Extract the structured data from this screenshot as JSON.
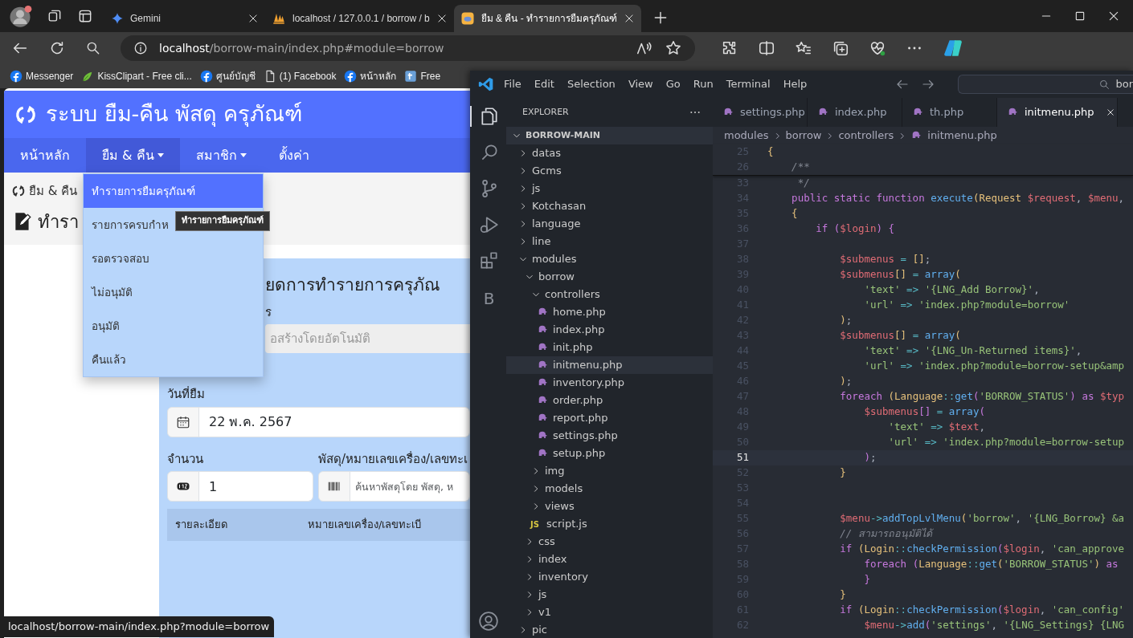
{
  "browser": {
    "tabs": [
      {
        "title": "Gemini",
        "kind": "sparkle",
        "selected": false
      },
      {
        "title": "localhost / 127.0.0.1 / borrow / b",
        "kind": "boat",
        "selected": false
      },
      {
        "title": "ยืม & คืน - ทำรายการยืมครุภัณฑ์",
        "kind": "app",
        "selected": true
      }
    ],
    "address": {
      "host": "localhost",
      "path": "/borrow-main/index.php#module=borrow"
    },
    "bookmarks": [
      {
        "label": "Messenger",
        "kind": "social"
      },
      {
        "label": "KissClipart - Free cli...",
        "kind": "leaf"
      },
      {
        "label": "ศูนย์บัญชี",
        "kind": "social"
      },
      {
        "label": "(1) Facebook",
        "kind": "page"
      },
      {
        "label": "หน้าหลัก",
        "kind": "social"
      },
      {
        "label": "Free",
        "kind": "tile"
      }
    ],
    "status_url": "localhost/borrow-main/index.php?module=borrow"
  },
  "page": {
    "site_title": "ระบบ ยืม-คืน พัสดุ ครุภัณฑ์",
    "nav": [
      {
        "label": "หน้าหลัก",
        "dropdown": false,
        "selected": false
      },
      {
        "label": "ยืม & คืน",
        "dropdown": true,
        "selected": true
      },
      {
        "label": "สมาชิก",
        "dropdown": true,
        "selected": false
      },
      {
        "label": "ตั้งค่า",
        "dropdown": false,
        "selected": false
      }
    ],
    "dropdown_menu": [
      {
        "label": "ทำรายการยืมครุภัณฑ์",
        "selected": true
      },
      {
        "label": "รายการครบกำห",
        "selected": false
      },
      {
        "label": "รอตรวจสอบ",
        "selected": false
      },
      {
        "label": "ไม่อนุมัติ",
        "selected": false
      },
      {
        "label": "อนุมัติ",
        "selected": false
      },
      {
        "label": "คืนแล้ว",
        "selected": false
      }
    ],
    "tooltip": "ทำรายการยืมครุภัณฑ์",
    "breadcrumb": "ยืม & คืน",
    "page_title": "ทำรา",
    "form": {
      "title": "ยดการทำรายการครุภัณ",
      "number_label": "ร",
      "number_placeholder": "อสร้างโดยอัตโนมัติ",
      "date_label": "วันที่ยืม",
      "date_value": "22 พ.ค. 2567",
      "quantity_label": "จำนวน",
      "quantity_value": "1",
      "item_label": "พัสดุ/หมายเลขเครื่อง/เลขทะเ",
      "item_placeholder": "ค้นหาพัสดุโดย พัสดุ, ห",
      "table_columns": [
        "รายละเอียด",
        "หมายเลขเครื่อง/เลขทะเบี"
      ]
    }
  },
  "vscode": {
    "menu": [
      "File",
      "Edit",
      "Selection",
      "View",
      "Go",
      "Run",
      "Terminal",
      "Help"
    ],
    "search": "bor",
    "activity": [
      {
        "kind": "files",
        "selected": true
      },
      {
        "kind": "search",
        "selected": false
      },
      {
        "kind": "source-control",
        "selected": false
      },
      {
        "kind": "debug",
        "selected": false
      },
      {
        "kind": "extensions",
        "selected": false
      },
      {
        "kind": "letter",
        "text": "B",
        "selected": false
      }
    ],
    "explorer": {
      "title": "EXPLORER",
      "root": {
        "label": "BORROW-MAIN",
        "kind": "folder",
        "expanded": true,
        "children": [
          {
            "label": "datas",
            "kind": "folder",
            "expanded": false,
            "selected": false
          },
          {
            "label": "Gcms",
            "kind": "folder",
            "expanded": false,
            "selected": false
          },
          {
            "label": "js",
            "kind": "folder",
            "expanded": false,
            "selected": false
          },
          {
            "label": "Kotchasan",
            "kind": "folder",
            "expanded": false,
            "selected": false
          },
          {
            "label": "language",
            "kind": "folder",
            "expanded": false,
            "selected": false
          },
          {
            "label": "line",
            "kind": "folder",
            "expanded": false,
            "selected": false
          },
          {
            "label": "modules",
            "kind": "folder",
            "expanded": true,
            "selected": false,
            "children": [
              {
                "label": "borrow",
                "kind": "folder",
                "expanded": true,
                "selected": false,
                "children": [
                  {
                    "label": "controllers",
                    "kind": "folder",
                    "expanded": true,
                    "selected": false,
                    "children": [
                      {
                        "label": "home.php",
                        "kind": "php",
                        "selected": false
                      },
                      {
                        "label": "index.php",
                        "kind": "php",
                        "selected": false
                      },
                      {
                        "label": "init.php",
                        "kind": "php",
                        "selected": false
                      },
                      {
                        "label": "initmenu.php",
                        "kind": "php",
                        "selected": true
                      },
                      {
                        "label": "inventory.php",
                        "kind": "php",
                        "selected": false
                      },
                      {
                        "label": "order.php",
                        "kind": "php",
                        "selected": false
                      },
                      {
                        "label": "report.php",
                        "kind": "php",
                        "selected": false
                      },
                      {
                        "label": "settings.php",
                        "kind": "php",
                        "selected": false
                      },
                      {
                        "label": "setup.php",
                        "kind": "php",
                        "selected": false
                      }
                    ]
                  },
                  {
                    "label": "img",
                    "kind": "folder",
                    "expanded": false,
                    "selected": false
                  },
                  {
                    "label": "models",
                    "kind": "folder",
                    "expanded": false,
                    "selected": false
                  },
                  {
                    "label": "views",
                    "kind": "folder",
                    "expanded": false,
                    "selected": false
                  },
                  {
                    "label": "script.js",
                    "kind": "js",
                    "icon_text": "JS",
                    "selected": false
                  }
                ]
              },
              {
                "label": "css",
                "kind": "folder",
                "expanded": false,
                "selected": false
              },
              {
                "label": "index",
                "kind": "folder",
                "expanded": false,
                "selected": false
              },
              {
                "label": "inventory",
                "kind": "folder",
                "expanded": false,
                "selected": false
              },
              {
                "label": "js",
                "kind": "folder",
                "expanded": false,
                "selected": false
              },
              {
                "label": "v1",
                "kind": "folder",
                "expanded": false,
                "selected": false
              }
            ]
          },
          {
            "label": "pic",
            "kind": "folder",
            "expanded": false,
            "selected": false
          }
        ]
      }
    },
    "editor_tabs": [
      {
        "label": "settings.php",
        "selected": false
      },
      {
        "label": "index.php",
        "selected": false
      },
      {
        "label": "th.php",
        "selected": false
      },
      {
        "label": "initmenu.php",
        "selected": true
      }
    ],
    "breadcrumb": [
      "modules",
      "borrow",
      "controllers",
      "initmenu.php"
    ],
    "sticky_lines": [
      {
        "number": "25",
        "tokens": [
          {
            "kind": "br",
            "text": "{"
          }
        ]
      },
      {
        "number": "26",
        "tokens": [
          {
            "kind": "comment",
            "text": "    /**"
          }
        ]
      }
    ],
    "lines": [
      {
        "number": "33",
        "current": false,
        "tokens": [
          {
            "kind": "comment",
            "text": "     */"
          }
        ]
      },
      {
        "number": "34",
        "current": false,
        "tokens": [
          {
            "kind": "kw",
            "text": "    public static function "
          },
          {
            "kind": "fn",
            "text": "execute"
          },
          {
            "kind": "br",
            "text": "("
          },
          {
            "kind": "cls",
            "text": "Request "
          },
          {
            "kind": "var",
            "text": "$request"
          },
          {
            "kind": "p",
            "text": ", "
          },
          {
            "kind": "var",
            "text": "$menu"
          },
          {
            "kind": "p",
            "text": ","
          }
        ]
      },
      {
        "number": "35",
        "current": false,
        "tokens": [
          {
            "kind": "br",
            "text": "    {"
          }
        ]
      },
      {
        "number": "36",
        "current": false,
        "tokens": [
          {
            "kind": "kw",
            "text": "        if "
          },
          {
            "kind": "br2",
            "text": "("
          },
          {
            "kind": "var",
            "text": "$login"
          },
          {
            "kind": "br2",
            "text": ") {"
          }
        ]
      },
      {
        "number": "37",
        "current": false
      },
      {
        "number": "38",
        "current": false,
        "tokens": [
          {
            "kind": "var",
            "text": "            $submenus"
          },
          {
            "kind": "op",
            "text": " = "
          },
          {
            "kind": "br",
            "text": "[]"
          },
          {
            "kind": "p",
            "text": ";"
          }
        ]
      },
      {
        "number": "39",
        "current": false,
        "tokens": [
          {
            "kind": "var",
            "text": "            $submenus"
          },
          {
            "kind": "br",
            "text": "[]"
          },
          {
            "kind": "op",
            "text": " = "
          },
          {
            "kind": "fn",
            "text": "array"
          },
          {
            "kind": "br",
            "text": "("
          }
        ]
      },
      {
        "number": "40",
        "current": false,
        "tokens": [
          {
            "kind": "str",
            "text": "                'text'"
          },
          {
            "kind": "op",
            "text": " => "
          },
          {
            "kind": "str",
            "text": "'{LNG_Add Borrow}'"
          },
          {
            "kind": "p",
            "text": ","
          }
        ]
      },
      {
        "number": "41",
        "current": false,
        "tokens": [
          {
            "kind": "str",
            "text": "                'url'"
          },
          {
            "kind": "op",
            "text": " => "
          },
          {
            "kind": "str",
            "text": "'index.php?module=borrow'"
          }
        ]
      },
      {
        "number": "42",
        "current": false,
        "tokens": [
          {
            "kind": "br",
            "text": "            )"
          },
          {
            "kind": "p",
            "text": ";"
          }
        ]
      },
      {
        "number": "43",
        "current": false,
        "tokens": [
          {
            "kind": "var",
            "text": "            $submenus"
          },
          {
            "kind": "br",
            "text": "[]"
          },
          {
            "kind": "op",
            "text": " = "
          },
          {
            "kind": "fn",
            "text": "array"
          },
          {
            "kind": "br",
            "text": "("
          }
        ]
      },
      {
        "number": "44",
        "current": false,
        "tokens": [
          {
            "kind": "str",
            "text": "                'text'"
          },
          {
            "kind": "op",
            "text": " => "
          },
          {
            "kind": "str",
            "text": "'{LNG_Un-Returned items}'"
          },
          {
            "kind": "p",
            "text": ","
          }
        ]
      },
      {
        "number": "45",
        "current": false,
        "tokens": [
          {
            "kind": "str",
            "text": "                'url'"
          },
          {
            "kind": "op",
            "text": " => "
          },
          {
            "kind": "str",
            "text": "'index.php?module=borrow-setup&amp"
          }
        ]
      },
      {
        "number": "46",
        "current": false,
        "tokens": [
          {
            "kind": "br",
            "text": "            )"
          },
          {
            "kind": "p",
            "text": ";"
          }
        ]
      },
      {
        "number": "47",
        "current": false,
        "tokens": [
          {
            "kind": "kw",
            "text": "            foreach "
          },
          {
            "kind": "br",
            "text": "("
          },
          {
            "kind": "cls",
            "text": "Language"
          },
          {
            "kind": "op",
            "text": "::"
          },
          {
            "kind": "fn",
            "text": "get"
          },
          {
            "kind": "br2",
            "text": "("
          },
          {
            "kind": "str",
            "text": "'BORROW_STATUS'"
          },
          {
            "kind": "br2",
            "text": ")"
          },
          {
            "kind": "kw",
            "text": " as "
          },
          {
            "kind": "var",
            "text": "$typ"
          }
        ]
      },
      {
        "number": "48",
        "current": false,
        "tokens": [
          {
            "kind": "var",
            "text": "                $submenus"
          },
          {
            "kind": "br2",
            "text": "[]"
          },
          {
            "kind": "op",
            "text": " = "
          },
          {
            "kind": "fn",
            "text": "array"
          },
          {
            "kind": "br2",
            "text": "("
          }
        ]
      },
      {
        "number": "49",
        "current": false,
        "tokens": [
          {
            "kind": "str",
            "text": "                    'text'"
          },
          {
            "kind": "op",
            "text": " => "
          },
          {
            "kind": "var",
            "text": "$text"
          },
          {
            "kind": "p",
            "text": ","
          }
        ]
      },
      {
        "number": "50",
        "current": false,
        "tokens": [
          {
            "kind": "str",
            "text": "                    'url'"
          },
          {
            "kind": "op",
            "text": " => "
          },
          {
            "kind": "str",
            "text": "'index.php?module=borrow-setup"
          }
        ]
      },
      {
        "number": "51",
        "current": true,
        "tokens": [
          {
            "kind": "br2",
            "text": "                )"
          },
          {
            "kind": "p",
            "text": ";"
          }
        ]
      },
      {
        "number": "52",
        "current": false,
        "tokens": [
          {
            "kind": "br",
            "text": "            }"
          }
        ]
      },
      {
        "number": "53",
        "current": false
      },
      {
        "number": "54",
        "current": false
      },
      {
        "number": "55",
        "current": false,
        "tokens": [
          {
            "kind": "var",
            "text": "            $menu"
          },
          {
            "kind": "op",
            "text": "->"
          },
          {
            "kind": "fn",
            "text": "addTopLvlMenu"
          },
          {
            "kind": "br",
            "text": "("
          },
          {
            "kind": "str",
            "text": "'borrow'"
          },
          {
            "kind": "p",
            "text": ", "
          },
          {
            "kind": "str",
            "text": "'{LNG_Borrow} &a"
          }
        ]
      },
      {
        "number": "56",
        "current": false,
        "tokens": [
          {
            "kind": "comment",
            "text": "            // สามารถอนุมัติได้"
          }
        ]
      },
      {
        "number": "57",
        "current": false,
        "tokens": [
          {
            "kind": "kw",
            "text": "            if "
          },
          {
            "kind": "br",
            "text": "("
          },
          {
            "kind": "cls",
            "text": "Login"
          },
          {
            "kind": "op",
            "text": "::"
          },
          {
            "kind": "fn",
            "text": "checkPermission"
          },
          {
            "kind": "br2",
            "text": "("
          },
          {
            "kind": "var",
            "text": "$login"
          },
          {
            "kind": "p",
            "text": ", "
          },
          {
            "kind": "str",
            "text": "'can_approve"
          }
        ]
      },
      {
        "number": "58",
        "current": false,
        "tokens": [
          {
            "kind": "kw",
            "text": "                foreach "
          },
          {
            "kind": "br2",
            "text": "("
          },
          {
            "kind": "cls",
            "text": "Language"
          },
          {
            "kind": "op",
            "text": "::"
          },
          {
            "kind": "fn",
            "text": "get"
          },
          {
            "kind": "br",
            "text": "("
          },
          {
            "kind": "str",
            "text": "'BORROW_STATUS'"
          },
          {
            "kind": "br",
            "text": ")"
          },
          {
            "kind": "kw",
            "text": " as"
          }
        ]
      },
      {
        "number": "59",
        "current": false,
        "tokens": [
          {
            "kind": "br2",
            "text": "                }"
          }
        ]
      },
      {
        "number": "60",
        "current": false,
        "tokens": [
          {
            "kind": "br",
            "text": "            }"
          }
        ]
      },
      {
        "number": "61",
        "current": false,
        "tokens": [
          {
            "kind": "kw",
            "text": "            if "
          },
          {
            "kind": "br",
            "text": "("
          },
          {
            "kind": "cls",
            "text": "Login"
          },
          {
            "kind": "op",
            "text": "::"
          },
          {
            "kind": "fn",
            "text": "checkPermission"
          },
          {
            "kind": "br2",
            "text": "("
          },
          {
            "kind": "var",
            "text": "$login"
          },
          {
            "kind": "p",
            "text": ", "
          },
          {
            "kind": "str",
            "text": "'can_config'"
          }
        ]
      },
      {
        "number": "62",
        "current": false,
        "tokens": [
          {
            "kind": "var",
            "text": "                $menu"
          },
          {
            "kind": "op",
            "text": "->"
          },
          {
            "kind": "fn",
            "text": "add"
          },
          {
            "kind": "br2",
            "text": "("
          },
          {
            "kind": "str",
            "text": "'settings'"
          },
          {
            "kind": "p",
            "text": ", "
          },
          {
            "kind": "str",
            "text": "'{LNG_Settings} {LNG"
          }
        ]
      }
    ]
  }
}
